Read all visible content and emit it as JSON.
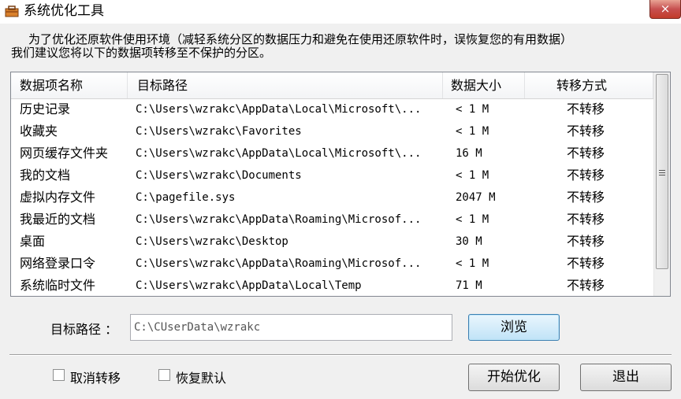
{
  "window": {
    "title": "系统优化工具",
    "close_glyph": "×"
  },
  "description": {
    "line1": "为了优化还原软件使用环境（减轻系统分区的数据压力和避免在使用还原软件时，误恢复您的有用数据）",
    "line2": "我们建议您将以下的数据项转移至不保护的分区。"
  },
  "table": {
    "headers": [
      "数据项名称",
      "目标路径",
      "数据大小",
      "转移方式"
    ],
    "rows": [
      {
        "name": "历史记录",
        "path": "C:\\Users\\wzrakc\\AppData\\Local\\Microsoft\\...",
        "size": "< 1 M",
        "mode": "不转移"
      },
      {
        "name": "收藏夹",
        "path": "C:\\Users\\wzrakc\\Favorites",
        "size": "< 1 M",
        "mode": "不转移"
      },
      {
        "name": "网页缓存文件夹",
        "path": "C:\\Users\\wzrakc\\AppData\\Local\\Microsoft\\...",
        "size": "16 M",
        "mode": "不转移"
      },
      {
        "name": "我的文档",
        "path": "C:\\Users\\wzrakc\\Documents",
        "size": "< 1 M",
        "mode": "不转移"
      },
      {
        "name": "虚拟内存文件",
        "path": "C:\\pagefile.sys",
        "size": "2047 M",
        "mode": "不转移"
      },
      {
        "name": "我最近的文档",
        "path": "C:\\Users\\wzrakc\\AppData\\Roaming\\Microsof...",
        "size": "< 1 M",
        "mode": "不转移"
      },
      {
        "name": "桌面",
        "path": "C:\\Users\\wzrakc\\Desktop",
        "size": "30 M",
        "mode": "不转移"
      },
      {
        "name": "网络登录口令",
        "path": "C:\\Users\\wzrakc\\AppData\\Roaming\\Microsof...",
        "size": "< 1 M",
        "mode": "不转移"
      },
      {
        "name": "系统临时文件",
        "path": "C:\\Users\\wzrakc\\AppData\\Local\\Temp",
        "size": "71 M",
        "mode": "不转移"
      }
    ]
  },
  "target": {
    "label": "目标路径 ：",
    "value": "C:\\CUserData\\wzrakc",
    "browse_label": "浏览"
  },
  "options": {
    "cancel_transfer": "取消转移",
    "restore_default": "恢复默认"
  },
  "actions": {
    "start_label": "开始优化",
    "exit_label": "退出"
  }
}
